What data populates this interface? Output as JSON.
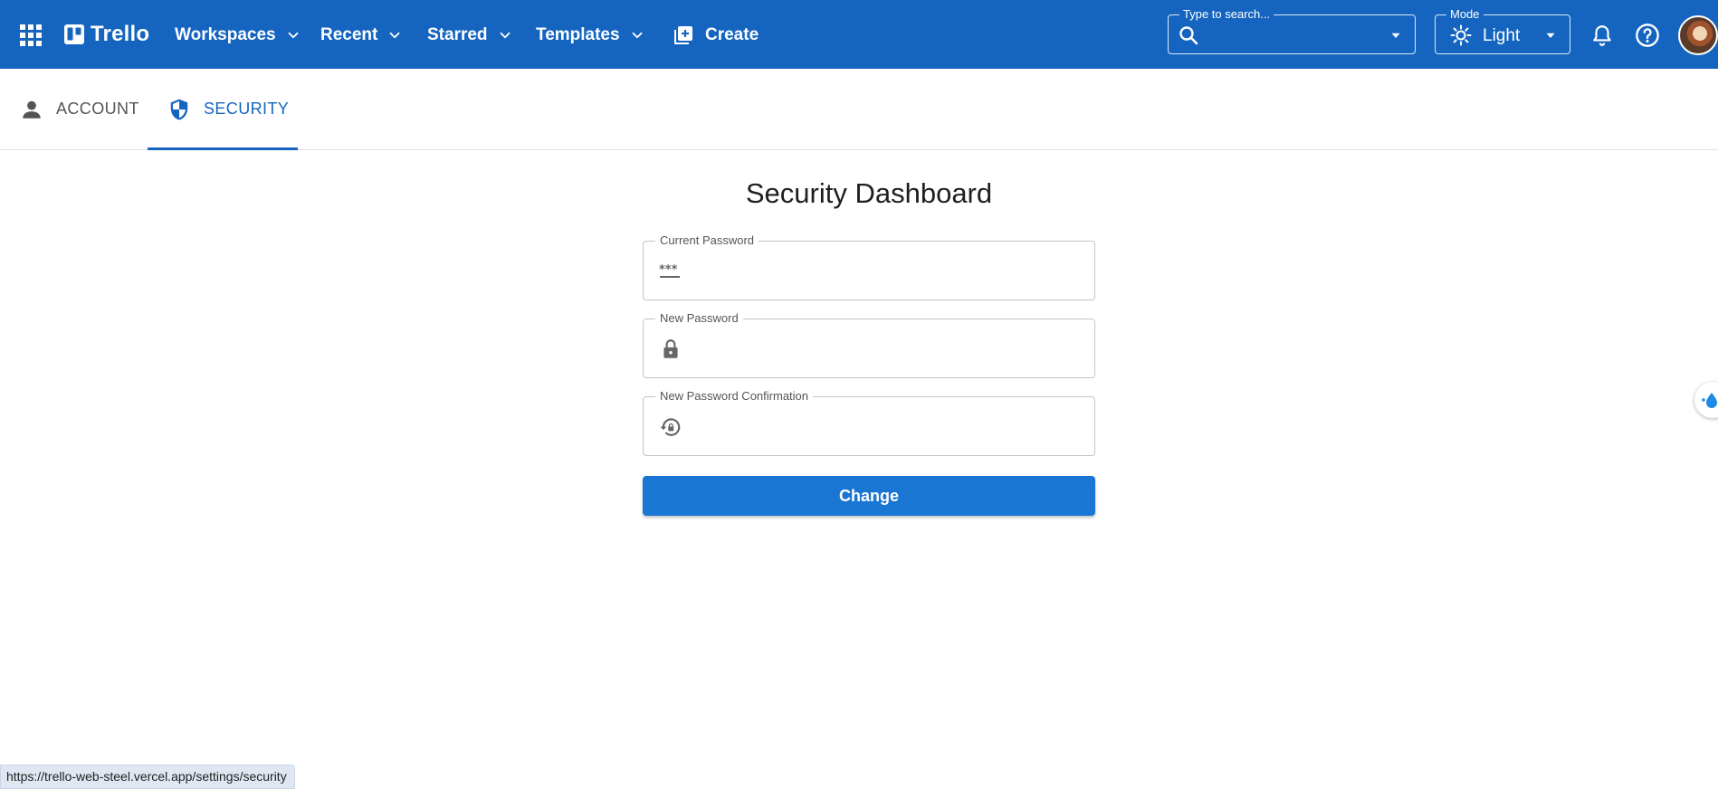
{
  "app": {
    "brand": "Trello",
    "nav": [
      {
        "label": "Workspaces"
      },
      {
        "label": "Recent"
      },
      {
        "label": "Starred"
      },
      {
        "label": "Templates"
      }
    ],
    "create_label": "Create",
    "search": {
      "legend": "Type to search...",
      "value": ""
    },
    "mode": {
      "legend": "Mode",
      "value": "Light"
    },
    "colors": {
      "bar": "#1565c0",
      "accent": "#1976d2"
    }
  },
  "tabs": [
    {
      "label": "ACCOUNT",
      "icon": "person-icon",
      "active": false
    },
    {
      "label": "SECURITY",
      "icon": "shield-icon",
      "active": true
    }
  ],
  "page": {
    "title": "Security Dashboard",
    "fields": [
      {
        "label": "Current Password",
        "icon": "password-icon",
        "value": ""
      },
      {
        "label": "New Password",
        "icon": "lock-icon",
        "value": ""
      },
      {
        "label": "New Password Confirmation",
        "icon": "lock-reset-icon",
        "value": ""
      }
    ],
    "submit_label": "Change"
  },
  "status_url": "https://trello-web-steel.vercel.app/settings/security"
}
